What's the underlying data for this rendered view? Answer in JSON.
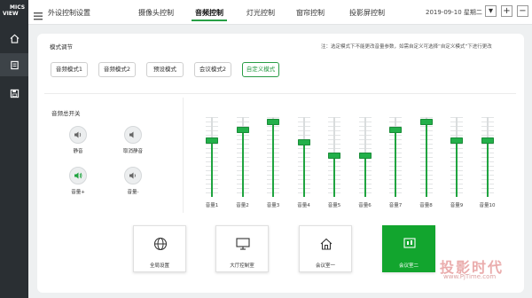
{
  "logo": {
    "line1": "MICS",
    "line2": "VIEW"
  },
  "app_title": "外设控制设置",
  "tabs": [
    {
      "label": "摄像头控制",
      "active": false
    },
    {
      "label": "音频控制",
      "active": true
    },
    {
      "label": "灯光控制",
      "active": false
    },
    {
      "label": "窗帘控制",
      "active": false
    },
    {
      "label": "投影屏控制",
      "active": false
    }
  ],
  "datetime": "2019-09-10 星期二",
  "window_buttons": {
    "minimize": "▾",
    "add": "+",
    "remove": "−"
  },
  "mode": {
    "title": "模式调节",
    "note": "注：选定模式下不能更改音量参数，如需自定义可选择“自定义模式”下进行更改",
    "buttons": [
      {
        "label": "音频模式1",
        "active": false
      },
      {
        "label": "音频模式2",
        "active": false
      },
      {
        "label": "预设模式",
        "active": false
      },
      {
        "label": "会议模式2",
        "active": false
      },
      {
        "label": "自定义模式",
        "active": true
      }
    ]
  },
  "master": {
    "title": "音频总开关",
    "controls": [
      {
        "label": "静音",
        "icon": "speaker-icon"
      },
      {
        "label": "取消静音",
        "icon": "speaker-muted-icon"
      },
      {
        "label": "音量+",
        "icon": "volume-up-icon"
      },
      {
        "label": "音量-",
        "icon": "volume-down-icon"
      }
    ]
  },
  "channels": [
    {
      "label": "音量1",
      "level": 0.72
    },
    {
      "label": "音量2",
      "level": 0.87
    },
    {
      "label": "音量3",
      "level": 0.97
    },
    {
      "label": "音量4",
      "level": 0.7
    },
    {
      "label": "音量5",
      "level": 0.52
    },
    {
      "label": "音量6",
      "level": 0.52
    },
    {
      "label": "音量7",
      "level": 0.87
    },
    {
      "label": "音量8",
      "level": 0.97
    },
    {
      "label": "音量9",
      "level": 0.72
    },
    {
      "label": "音量10",
      "level": 0.72
    }
  ],
  "scenes": [
    {
      "label": "全局设置",
      "icon": "globe-icon",
      "active": false
    },
    {
      "label": "大厅控制室",
      "icon": "monitor-icon",
      "active": false
    },
    {
      "label": "会议室一",
      "icon": "house-icon",
      "active": false
    },
    {
      "label": "会议室二",
      "icon": "presentation-icon",
      "active": true
    }
  ],
  "watermark": {
    "text": "投影时代",
    "url": "www.PjTime.com"
  },
  "colors": {
    "accent": "#1fa43f",
    "sidebar": "#2a2f33",
    "active_card": "#12a52e"
  }
}
